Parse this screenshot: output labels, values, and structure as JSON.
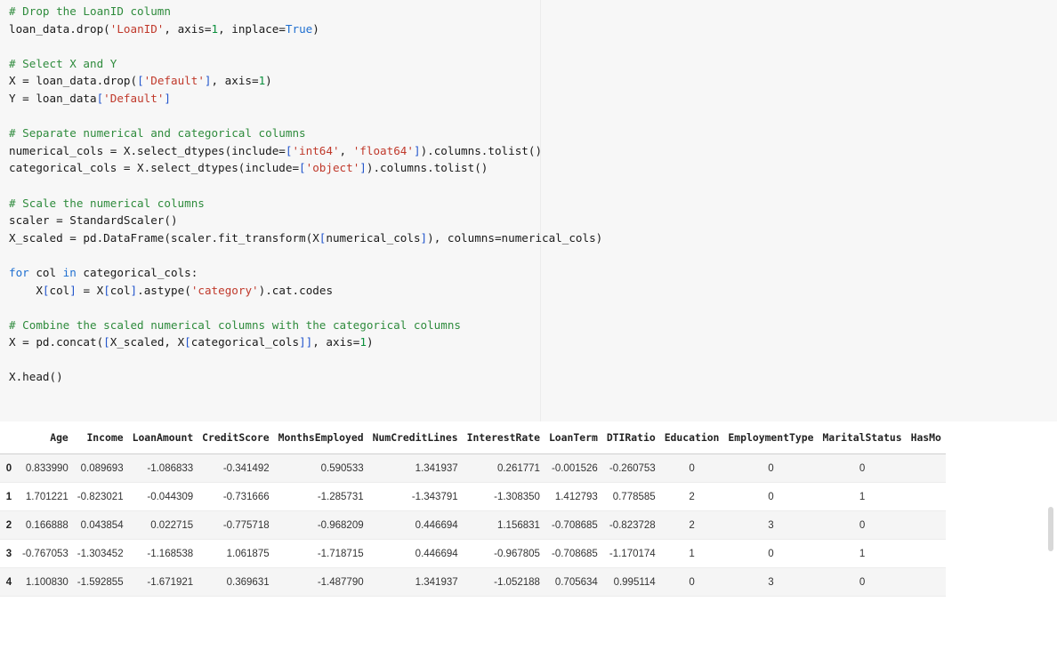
{
  "code_cell": {
    "lines": [
      [
        {
          "t": "# Drop the LoanID column",
          "c": "cm"
        }
      ],
      [
        {
          "t": "loan_data.drop(",
          "c": ""
        },
        {
          "t": "'LoanID'",
          "c": "st"
        },
        {
          "t": ", axis=",
          "c": ""
        },
        {
          "t": "1",
          "c": "nm"
        },
        {
          "t": ", inplace=",
          "c": ""
        },
        {
          "t": "True",
          "c": "kw"
        },
        {
          "t": ")",
          "c": ""
        }
      ],
      [],
      [
        {
          "t": "# Select X and Y",
          "c": "cm"
        }
      ],
      [
        {
          "t": "X = loan_data.drop(",
          "c": ""
        },
        {
          "t": "[",
          "c": "br"
        },
        {
          "t": "'Default'",
          "c": "st"
        },
        {
          "t": "]",
          "c": "br"
        },
        {
          "t": ", axis=",
          "c": ""
        },
        {
          "t": "1",
          "c": "nm"
        },
        {
          "t": ")",
          "c": ""
        }
      ],
      [
        {
          "t": "Y = loan_data",
          "c": ""
        },
        {
          "t": "[",
          "c": "br"
        },
        {
          "t": "'Default'",
          "c": "st"
        },
        {
          "t": "]",
          "c": "br"
        }
      ],
      [],
      [
        {
          "t": "# Separate numerical and categorical columns",
          "c": "cm"
        }
      ],
      [
        {
          "t": "numerical_cols = X.select_dtypes(include=",
          "c": ""
        },
        {
          "t": "[",
          "c": "br"
        },
        {
          "t": "'int64'",
          "c": "st"
        },
        {
          "t": ", ",
          "c": ""
        },
        {
          "t": "'float64'",
          "c": "st"
        },
        {
          "t": "]",
          "c": "br"
        },
        {
          "t": ").columns.tolist()",
          "c": ""
        }
      ],
      [
        {
          "t": "categorical_cols = X.select_dtypes(include=",
          "c": ""
        },
        {
          "t": "[",
          "c": "br"
        },
        {
          "t": "'object'",
          "c": "st"
        },
        {
          "t": "]",
          "c": "br"
        },
        {
          "t": ").columns.tolist()",
          "c": ""
        }
      ],
      [],
      [
        {
          "t": "# Scale the numerical columns",
          "c": "cm"
        }
      ],
      [
        {
          "t": "scaler = StandardScaler()",
          "c": ""
        }
      ],
      [
        {
          "t": "X_scaled = pd.DataFrame(scaler.fit_transform(X",
          "c": ""
        },
        {
          "t": "[",
          "c": "br"
        },
        {
          "t": "numerical_cols",
          "c": ""
        },
        {
          "t": "]",
          "c": "br"
        },
        {
          "t": "), columns=numerical_cols)",
          "c": ""
        }
      ],
      [],
      [
        {
          "t": "for",
          "c": "kw"
        },
        {
          "t": " col ",
          "c": ""
        },
        {
          "t": "in",
          "c": "kw"
        },
        {
          "t": " categorical_cols:",
          "c": ""
        }
      ],
      [
        {
          "t": "    X",
          "c": ""
        },
        {
          "t": "[",
          "c": "br"
        },
        {
          "t": "col",
          "c": ""
        },
        {
          "t": "]",
          "c": "br"
        },
        {
          "t": " = X",
          "c": ""
        },
        {
          "t": "[",
          "c": "br"
        },
        {
          "t": "col",
          "c": ""
        },
        {
          "t": "]",
          "c": "br"
        },
        {
          "t": ".astype(",
          "c": ""
        },
        {
          "t": "'category'",
          "c": "st"
        },
        {
          "t": ").cat.codes",
          "c": ""
        }
      ],
      [],
      [
        {
          "t": "# Combine the scaled numerical columns with the categorical columns",
          "c": "cm"
        }
      ],
      [
        {
          "t": "X = pd.concat(",
          "c": ""
        },
        {
          "t": "[",
          "c": "br"
        },
        {
          "t": "X_scaled, X",
          "c": ""
        },
        {
          "t": "[",
          "c": "br"
        },
        {
          "t": "categorical_cols",
          "c": ""
        },
        {
          "t": "]",
          "c": "br"
        },
        {
          "t": "]",
          "c": "br"
        },
        {
          "t": ", axis=",
          "c": ""
        },
        {
          "t": "1",
          "c": "nm"
        },
        {
          "t": ")",
          "c": ""
        }
      ],
      [],
      [
        {
          "t": "X.head()",
          "c": ""
        }
      ]
    ]
  },
  "output_table": {
    "columns": [
      "",
      "Age",
      "Income",
      "LoanAmount",
      "CreditScore",
      "MonthsEmployed",
      "NumCreditLines",
      "InterestRate",
      "LoanTerm",
      "DTIRatio",
      "Education",
      "EmploymentType",
      "MaritalStatus",
      "HasMo"
    ],
    "rows": [
      [
        "0",
        "0.833990",
        "0.089693",
        "-1.086833",
        "-0.341492",
        "0.590533",
        "1.341937",
        "0.261771",
        "-0.001526",
        "-0.260753",
        "0",
        "0",
        "0",
        ""
      ],
      [
        "1",
        "1.701221",
        "-0.823021",
        "-0.044309",
        "-0.731666",
        "-1.285731",
        "-1.343791",
        "-1.308350",
        "1.412793",
        "0.778585",
        "2",
        "0",
        "1",
        ""
      ],
      [
        "2",
        "0.166888",
        "0.043854",
        "0.022715",
        "-0.775718",
        "-0.968209",
        "0.446694",
        "1.156831",
        "-0.708685",
        "-0.823728",
        "2",
        "3",
        "0",
        ""
      ],
      [
        "3",
        "-0.767053",
        "-1.303452",
        "-1.168538",
        "1.061875",
        "-1.718715",
        "0.446694",
        "-0.967805",
        "-0.708685",
        "-1.170174",
        "1",
        "0",
        "1",
        ""
      ],
      [
        "4",
        "1.100830",
        "-1.592855",
        "-1.671921",
        "0.369631",
        "-1.487790",
        "1.341937",
        "-1.052188",
        "0.705634",
        "0.995114",
        "0",
        "3",
        "0",
        ""
      ]
    ]
  }
}
